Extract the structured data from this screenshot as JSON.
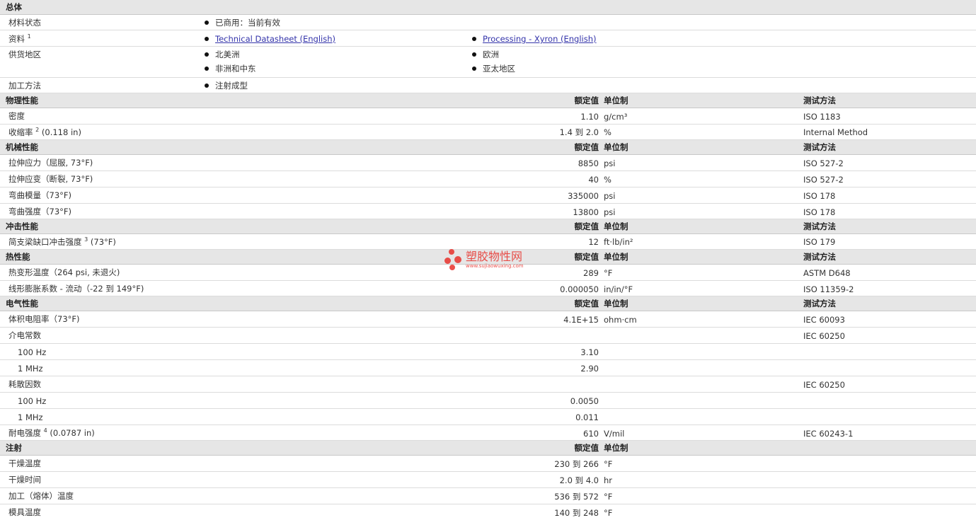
{
  "general": {
    "title": "总体",
    "status_label": "材料状态",
    "status_value": "已商用：当前有效",
    "docs_label": "资料",
    "docs_sup": "1",
    "docs_link1": "Technical Datasheet (English)",
    "docs_link2": "Processing - Xyron (English)",
    "region_label": "供货地区",
    "region1": "北美洲",
    "region2": "欧洲",
    "region3": "非洲和中东",
    "region4": "亚太地区",
    "method_label": "加工方法",
    "method_value": "注射成型"
  },
  "headers": {
    "nominal": "额定值",
    "unit": "单位制",
    "test": "测试方法"
  },
  "physical": {
    "title": "物理性能",
    "rows": [
      {
        "name": "密度",
        "sup": "",
        "cond": "",
        "value": "1.10",
        "unit": "g/cm³",
        "test": "ISO 1183"
      },
      {
        "name": "收缩率",
        "sup": "2",
        "cond": "(0.118 in)",
        "value": "1.4 到  2.0",
        "unit": "%",
        "test": "Internal Method"
      }
    ]
  },
  "mechanical": {
    "title": "机械性能",
    "rows": [
      {
        "name": "拉伸应力（屈服, 73°F)",
        "value": "8850",
        "unit": "psi",
        "test": "ISO 527-2"
      },
      {
        "name": "拉伸应变（断裂, 73°F)",
        "value": "40",
        "unit": "%",
        "test": "ISO 527-2"
      },
      {
        "name": "弯曲模量（73°F)",
        "value": "335000",
        "unit": "psi",
        "test": "ISO 178"
      },
      {
        "name": "弯曲强度（73°F)",
        "value": "13800",
        "unit": "psi",
        "test": "ISO 178"
      }
    ]
  },
  "impact": {
    "title": "冲击性能",
    "rows": [
      {
        "name": "简支梁缺口冲击强度",
        "sup": "3",
        "cond": "(73°F)",
        "value": "12",
        "unit": "ft·lb/in²",
        "test": "ISO 179"
      }
    ]
  },
  "thermal": {
    "title": "热性能",
    "rows": [
      {
        "name": "热变形温度（264 psi, 未退火)",
        "value": "289",
        "unit": "°F",
        "test": "ASTM D648"
      },
      {
        "name": "线形膨胀系数 - 流动（-22 到  149°F)",
        "value": "0.000050",
        "unit": "in/in/°F",
        "test": "ISO 11359-2"
      }
    ]
  },
  "electrical": {
    "title": "电气性能",
    "rows": [
      {
        "name": "体积电阻率（73°F)",
        "value": "4.1E+15",
        "unit": "ohm·cm",
        "test": "IEC 60093"
      },
      {
        "name": "介电常数",
        "value": "",
        "unit": "",
        "test": "IEC 60250"
      },
      {
        "name": "100 Hz",
        "value": "3.10",
        "unit": "",
        "test": ""
      },
      {
        "name": "1 MHz",
        "value": "2.90",
        "unit": "",
        "test": ""
      },
      {
        "name": "耗散因数",
        "value": "",
        "unit": "",
        "test": "IEC 60250"
      },
      {
        "name": "100 Hz",
        "value": "0.0050",
        "unit": "",
        "test": ""
      },
      {
        "name": "1 MHz",
        "value": "0.011",
        "unit": "",
        "test": ""
      }
    ],
    "strength": {
      "name": "耐电强度",
      "sup": "4",
      "cond": "(0.0787 in)",
      "value": "610",
      "unit": "V/mil",
      "test": "IEC 60243-1"
    }
  },
  "injection": {
    "title": "注射",
    "rows": [
      {
        "name": "干燥温度",
        "value": "230 到  266",
        "unit": "°F"
      },
      {
        "name": "干燥时间",
        "value": "2.0 到  4.0",
        "unit": "hr"
      },
      {
        "name": "加工（熔体）温度",
        "value": "536 到  572",
        "unit": "°F"
      },
      {
        "name": "模具温度",
        "value": "140 到  248",
        "unit": "°F"
      }
    ]
  },
  "watermark": {
    "brand": "塑胶物性网",
    "url": "www.sujiaowuxing.com",
    "color": "#e8322c"
  }
}
